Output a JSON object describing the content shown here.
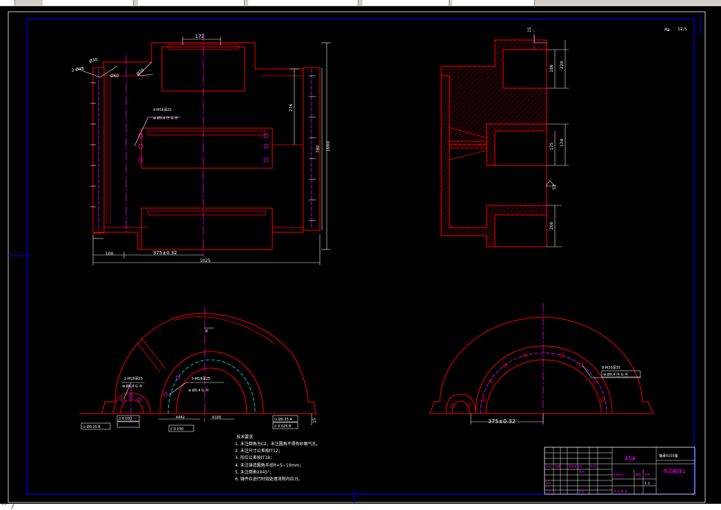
{
  "tabs": [
    {
      "label": ""
    },
    {
      "label": ""
    },
    {
      "label": ""
    },
    {
      "label": ""
    },
    {
      "label": ""
    },
    {
      "label": ""
    }
  ],
  "drawing": {
    "roughness": {
      "symbol": "Ra",
      "value": "12.5"
    },
    "top_view": {
      "dim_width": "172",
      "dim_height_total": "1000",
      "dim_inner_height": "780",
      "dim_mid": "276",
      "dim_bottom_left": "100",
      "dim_bottom_center": "375±0.32",
      "dim_bottom_total": "1025",
      "callout_1": "4-M16深25",
      "callout_1_tol": "⊕ Ø0.4 Ⓜ G Ⓜ",
      "label_a": "Ø30",
      "label_b": "Ø60",
      "label_c": "Ø70",
      "label_d": "2-Ø48"
    },
    "side_view": {
      "dim_top": "15",
      "dim_1": "186",
      "dim_2": "228",
      "dim_3": "175",
      "dim_4": "174",
      "dim_5": "200",
      "dim_angle": "52"
    },
    "front_left": {
      "callout_a": "2-M16深25",
      "callout_a_tol": "⊕ Ø0.4 G Ⓜ",
      "callout_b": "5-M16深25",
      "callout_b_tol": "⊕ Ø0.4 G Ⓜ",
      "dim_b": "B",
      "tol_1": "// 0.030",
      "tol_2": "⊙ Ø0.25 B",
      "tol_3": "⊙ Ø0.25 A",
      "tol_4": "// 0.025 B",
      "tol_5": "// 0.030",
      "dim_r1": "A442",
      "dim_r2": "R100",
      "dim_side": "15"
    },
    "front_right": {
      "callout": "8-M20深35",
      "callout_tol": "⊕ Ø0.4 Ⓜ G Ⓜ",
      "dim_bottom": "375±0.32"
    },
    "notes": {
      "heading": "技术要求",
      "lines": [
        "1. 未注倒角为C2，未注圆角不得有砂眼气孔。",
        "2. 未注尺寸公差按IT12；",
        "3. 形位公差按IT18；",
        "4. 未注铸造圆角半径R=5~10mm；",
        "5. 未注倒角2X45°；",
        "6. 铸件应进行时效处理消除内应力。"
      ]
    },
    "title_block": {
      "material": "45#",
      "drawing_no": "轴承0103座",
      "part_name": "传动箱体1",
      "scale": "1:1"
    }
  },
  "status": {
    "text": "ﾟﾟ /"
  },
  "colors": {
    "background": "#000000",
    "frame": "#0000ff",
    "geometry": "#ff0000",
    "dimension": "#ffffff",
    "centerline": "#ff00ff",
    "hidden": "#00ffff",
    "title_block": "#ff00ff"
  }
}
